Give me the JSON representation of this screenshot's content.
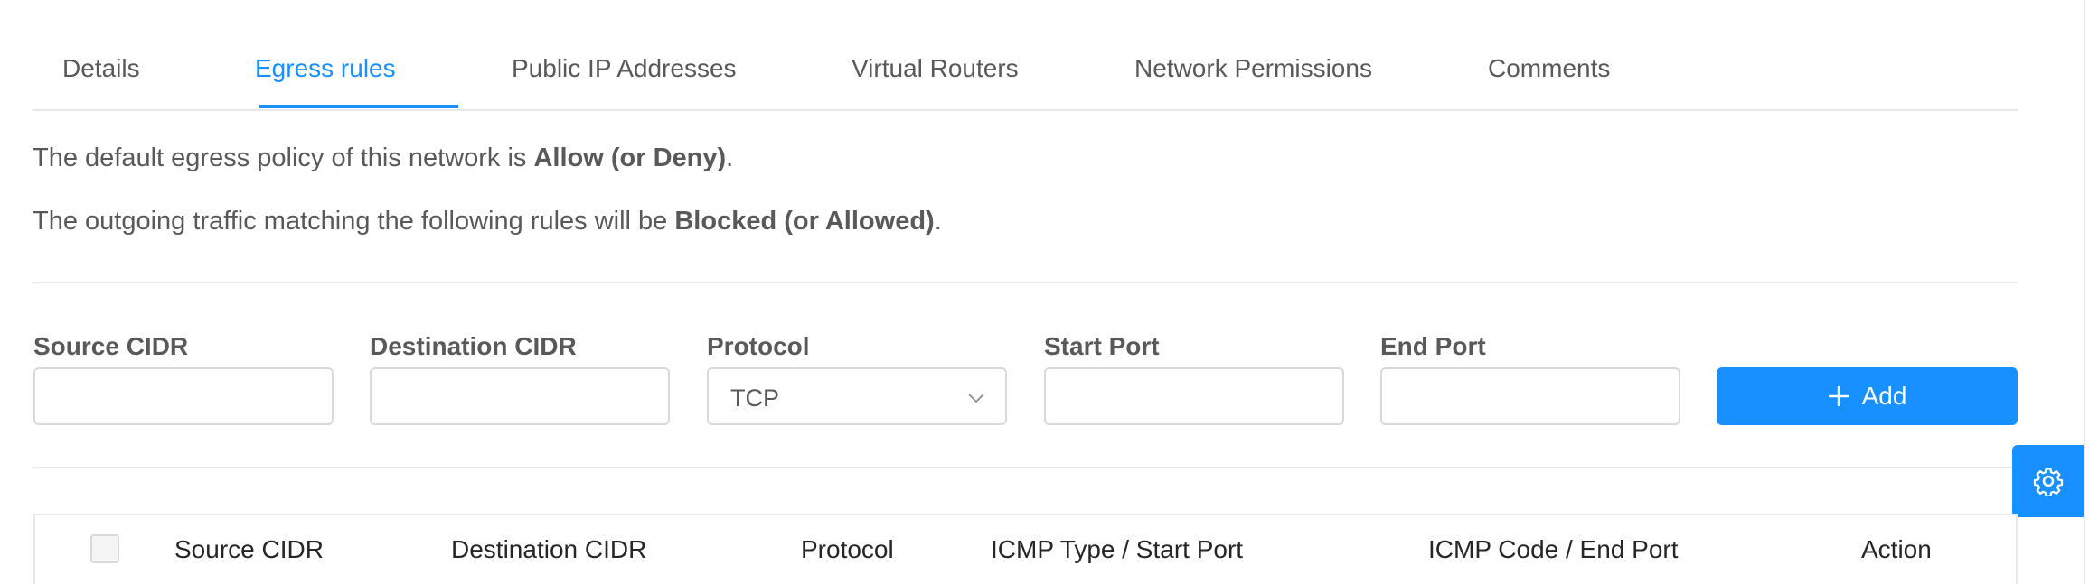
{
  "tabs": [
    {
      "label": "Details",
      "active": false
    },
    {
      "label": "Egress rules",
      "active": true
    },
    {
      "label": "Public IP Addresses",
      "active": false
    },
    {
      "label": "Virtual Routers",
      "active": false
    },
    {
      "label": "Network Permissions",
      "active": false
    },
    {
      "label": "Comments",
      "active": false
    }
  ],
  "info": {
    "policy_prefix": "The default egress policy of this network is ",
    "policy_value": "Allow (or Deny)",
    "policy_suffix": ".",
    "traffic_prefix": "The outgoing traffic matching the following rules will be ",
    "traffic_value": "Blocked (or Allowed)",
    "traffic_suffix": "."
  },
  "form": {
    "source_cidr": {
      "label": "Source CIDR",
      "value": "",
      "placeholder": ""
    },
    "destination_cidr": {
      "label": "Destination CIDR",
      "value": "",
      "placeholder": ""
    },
    "protocol": {
      "label": "Protocol",
      "value": "TCP"
    },
    "start_port": {
      "label": "Start Port",
      "value": "",
      "placeholder": ""
    },
    "end_port": {
      "label": "End Port",
      "value": "",
      "placeholder": ""
    },
    "add_label": "Add"
  },
  "table": {
    "columns": [
      "Source CIDR",
      "Destination CIDR",
      "Protocol",
      "ICMP Type / Start Port",
      "ICMP Code / End Port",
      "Action"
    ]
  },
  "icons": {
    "add": "plus-icon",
    "settings": "gear-icon",
    "select": "chevron-down-icon"
  },
  "colors": {
    "accent": "#1890ff",
    "text": "#595959",
    "border": "#d9d9d9"
  }
}
